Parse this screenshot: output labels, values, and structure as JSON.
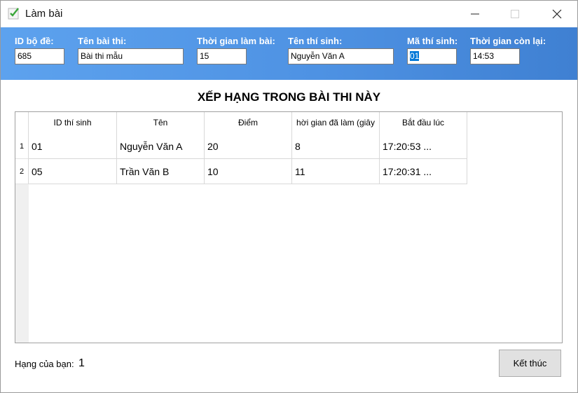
{
  "window": {
    "title": "Làm bài"
  },
  "header": {
    "exam_id": {
      "label": "ID bộ đề:",
      "value": "685"
    },
    "exam_name": {
      "label": "Tên bài thi:",
      "value": "Bài thi mẫu"
    },
    "duration": {
      "label": "Thời gian làm bài:",
      "value": "15"
    },
    "student_name": {
      "label": "Tên thí sinh:",
      "value": "Nguyễn Văn A"
    },
    "student_id": {
      "label": "Mã thí sinh:",
      "value": "01"
    },
    "time_left": {
      "label": "Thời gian còn lại:",
      "value": "14:53"
    }
  },
  "ranking": {
    "title": "XẾP HẠNG TRONG BÀI THI NÀY",
    "columns": [
      "ID thí sinh",
      "Tên",
      "Điểm",
      "hời gian đã làm (giây",
      "Bắt đầu lúc"
    ],
    "rows": [
      {
        "num": "1",
        "cells": [
          "01",
          "Nguyễn Văn A",
          "20",
          "8",
          "17:20:53 ..."
        ]
      },
      {
        "num": "2",
        "cells": [
          "05",
          "Trần Văn B",
          "10",
          "11",
          "17:20:31 ..."
        ]
      }
    ]
  },
  "footer": {
    "rank_label": "Hạng của bạn:",
    "rank_value": "1",
    "finish_label": "Kết thúc"
  },
  "colors": {
    "header_start": "#5da2ee",
    "header_end": "#3f80d2",
    "selection": "#0078d7"
  },
  "icons": {
    "app": "checkmark-app-icon",
    "minimize": "minimize-icon",
    "maximize": "maximize-icon",
    "close": "close-icon"
  }
}
